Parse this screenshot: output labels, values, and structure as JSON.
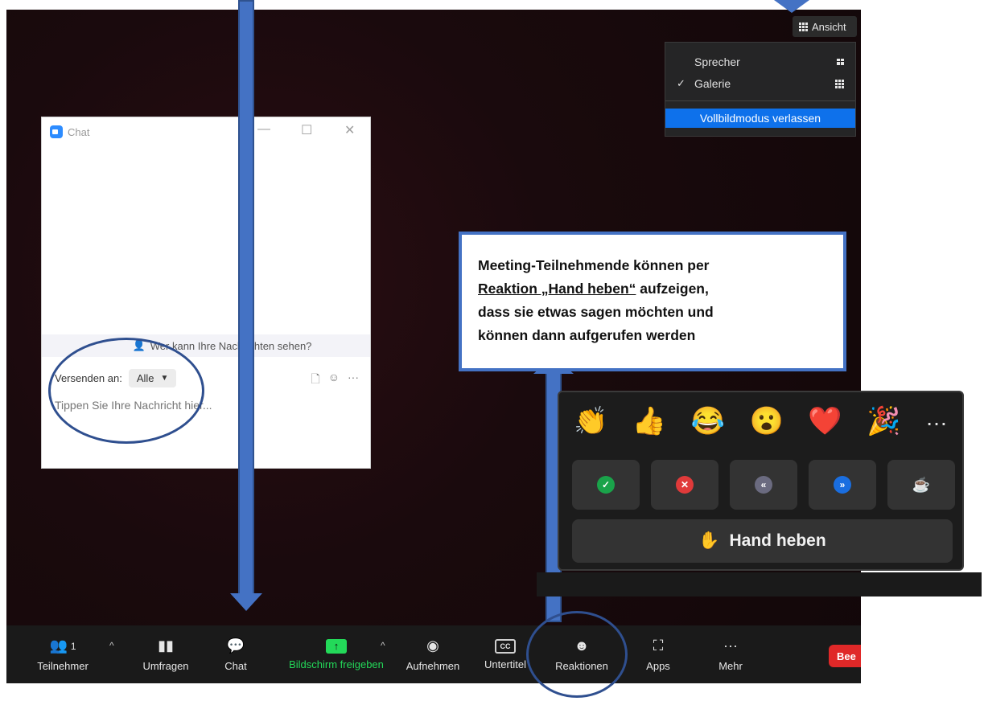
{
  "view_menu": {
    "button_label": "Ansicht",
    "items": [
      {
        "label": "Sprecher",
        "checked": false,
        "icon": "speaker-layout-icon"
      },
      {
        "label": "Galerie",
        "checked": true,
        "icon": "gallery-grid-icon"
      }
    ],
    "exit_fullscreen_label": "Vollbildmodus verlassen",
    "highlight_color": "#0e71eb"
  },
  "chat": {
    "title": "Chat",
    "privacy_text": "Wer kann Ihre Nachrichten sehen?",
    "send_to_label": "Versenden an:",
    "send_to_value": "Alle",
    "message_placeholder": "Tippen Sie Ihre Nachricht hier..."
  },
  "callout": {
    "line1": "Meeting-Teilnehmende können per",
    "underlined": "Reaktion „Hand heben“",
    "line2_rest": " aufzeigen,",
    "line3": "dass sie etwas sagen möchten und",
    "line4": "können dann aufgerufen werden",
    "border_color": "#4472c4"
  },
  "reactions": {
    "emojis": [
      "👏",
      "👍",
      "😂",
      "😮",
      "❤️",
      "🎉",
      "…"
    ],
    "actions": [
      {
        "name": "yes-icon",
        "symbol": "✓",
        "color": "#1aa34a"
      },
      {
        "name": "no-icon",
        "symbol": "✕",
        "color": "#e03a3a"
      },
      {
        "name": "slow-down-icon",
        "symbol": "«",
        "color": "#6b6b80"
      },
      {
        "name": "speed-up-icon",
        "symbol": "»",
        "color": "#1a6ee0"
      },
      {
        "name": "coffee-icon",
        "symbol": "☕",
        "color": "transparent"
      }
    ],
    "raise_hand_label": "Hand heben",
    "raise_hand_emoji": "✋"
  },
  "toolbar": {
    "participants_label": "Teilnehmer",
    "participants_count": "1",
    "polls_label": "Umfragen",
    "chat_label": "Chat",
    "share_label": "Bildschirm freigeben",
    "share_color": "#23d959",
    "record_label": "Aufnehmen",
    "captions_label": "Untertitel",
    "captions_icon_text": "CC",
    "reactions_label": "Reaktionen",
    "apps_label": "Apps",
    "more_label": "Mehr",
    "end_label": "Bee",
    "end_color": "#e02828"
  }
}
